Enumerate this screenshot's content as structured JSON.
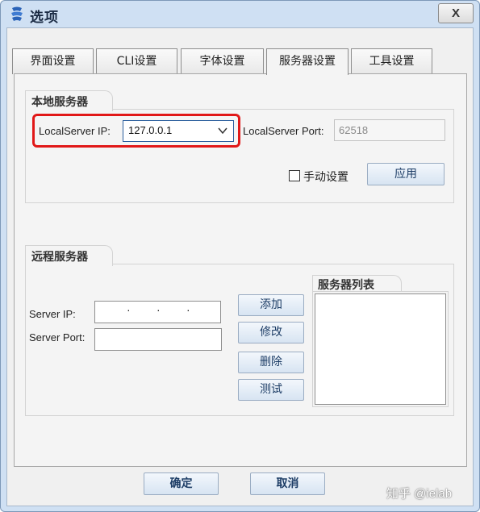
{
  "window": {
    "title": "选项",
    "close_label": "X"
  },
  "tabs": [
    {
      "label": "界面设置",
      "active": false
    },
    {
      "label": "CLI设置",
      "active": false
    },
    {
      "label": "字体设置",
      "active": false
    },
    {
      "label": "服务器设置",
      "active": true
    },
    {
      "label": "工具设置",
      "active": false
    }
  ],
  "local_server": {
    "group_title": "本地服务器",
    "ip_label": "LocalServer IP:",
    "ip_value": "127.0.0.1",
    "port_label": "LocalServer Port:",
    "port_value": "62518",
    "manual_label": "手动设置",
    "manual_checked": false,
    "apply_label": "应用"
  },
  "remote_server": {
    "group_title": "远程服务器",
    "ip_label": "Server IP:",
    "port_label": "Server Port:",
    "port_value": "",
    "list_title": "服务器列表",
    "add_label": "添加",
    "modify_label": "修改",
    "delete_label": "删除",
    "test_label": "测试"
  },
  "footer": {
    "ok_label": "确定",
    "cancel_label": "取消"
  },
  "watermark": "知乎 @ielab",
  "colors": {
    "frame": "#cfe0f3",
    "highlight": "#e11818",
    "button_text": "#1d3d66"
  }
}
